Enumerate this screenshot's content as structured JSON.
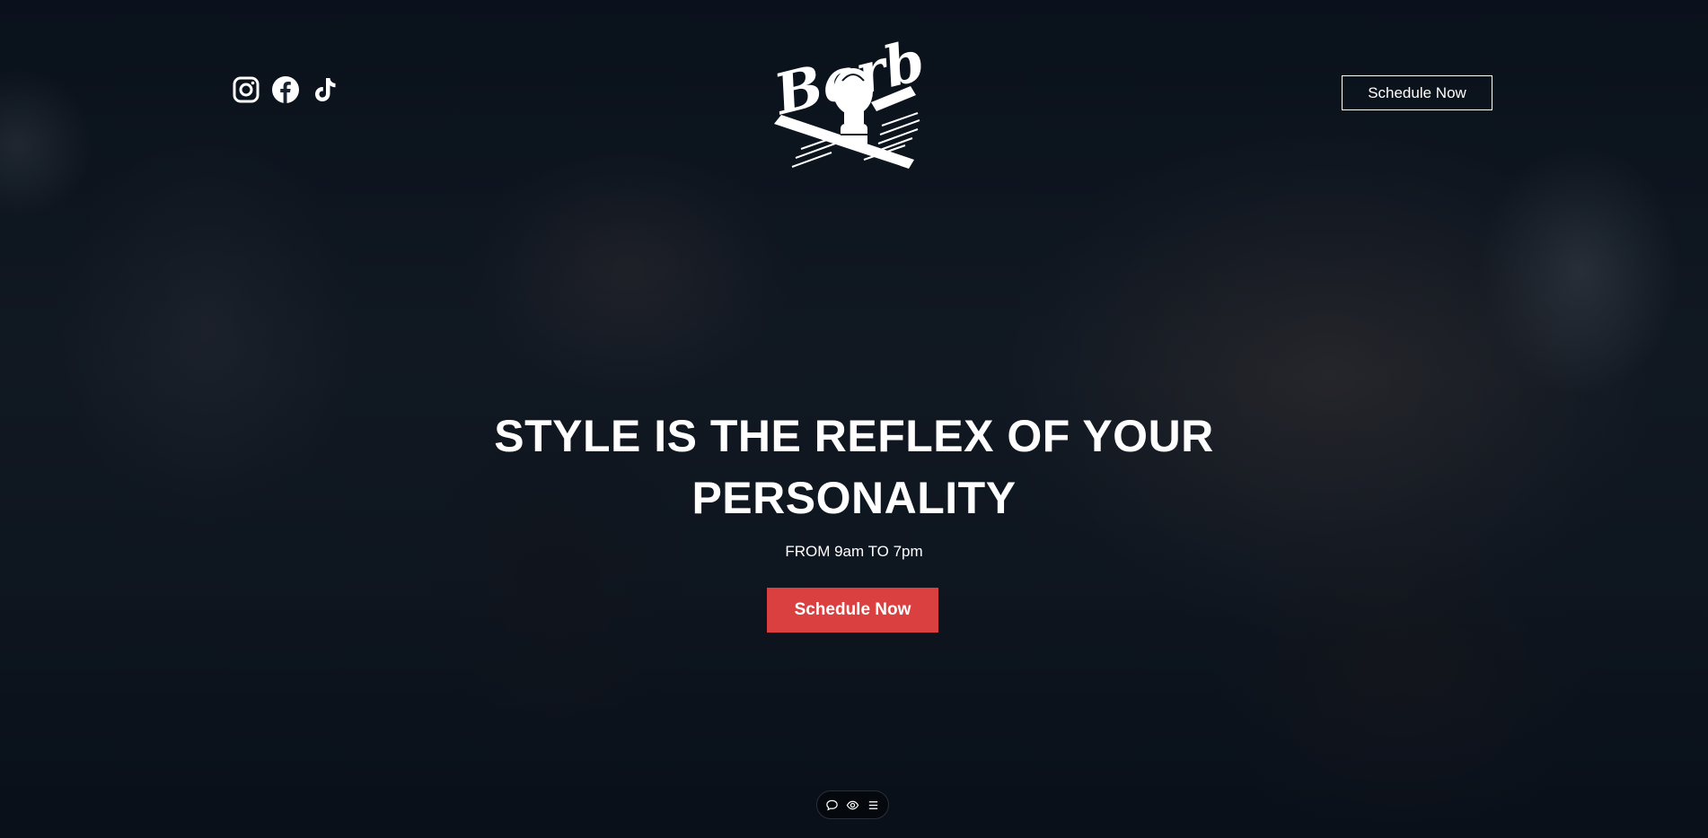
{
  "header": {
    "social": [
      {
        "icon": "instagram-icon"
      },
      {
        "icon": "facebook-icon"
      },
      {
        "icon": "tiktok-icon"
      }
    ],
    "logo_text": "Barber",
    "cta_label": "Schedule Now"
  },
  "hero": {
    "headline_line1": "STYLE IS THE REFLEX OF YOUR",
    "headline_line2": "PERSONALITY",
    "hours": "FROM 9am TO 7pm",
    "cta_label": "Schedule Now"
  },
  "bottom_toolbar": {
    "icons": [
      "chat-icon",
      "eye-icon",
      "menu-icon"
    ]
  },
  "colors": {
    "accent": "#d9403f",
    "background": "#0e1622",
    "text": "#ffffff"
  }
}
